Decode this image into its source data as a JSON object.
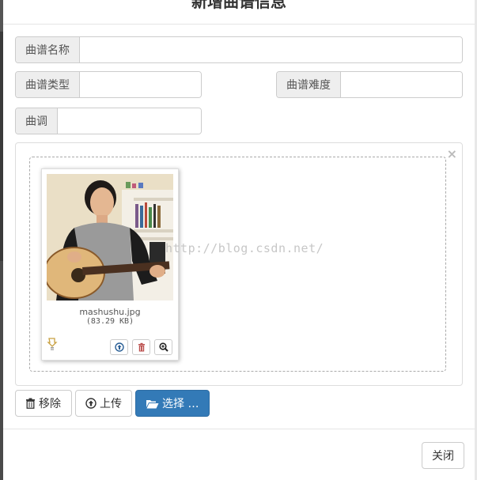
{
  "modal": {
    "title": "新增曲谱信息"
  },
  "form": {
    "score_name": {
      "label": "曲谱名称",
      "value": ""
    },
    "score_type": {
      "label": "曲谱类型",
      "value": ""
    },
    "score_difficulty": {
      "label": "曲谱难度",
      "value": ""
    },
    "score_key": {
      "label": "曲调",
      "value": ""
    }
  },
  "file_preview": {
    "filename": "mashushu.jpg",
    "filesize": "(83.29 KB)",
    "actions": [
      "upload-icon",
      "trash-icon",
      "zoom-in-icon"
    ]
  },
  "buttons": {
    "remove": "移除",
    "upload": "上传",
    "browse": "选择 …",
    "close": "关闭"
  },
  "watermark": "http://blog.csdn.net/",
  "colors": {
    "primary": "#337ab7",
    "border": "#cccccc",
    "addon_bg": "#eeeeee"
  }
}
